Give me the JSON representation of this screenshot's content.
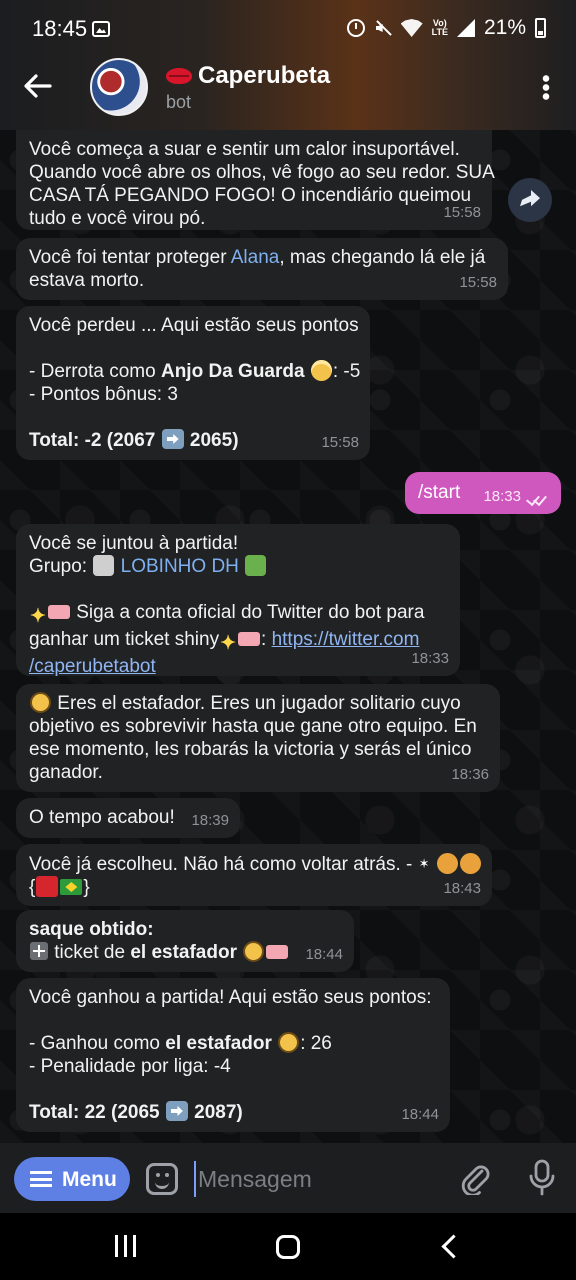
{
  "status_bar": {
    "time": "18:45",
    "battery": "21%",
    "volte_line1": "Vo)",
    "volte_line2": "LTE"
  },
  "header": {
    "title": "Caperubeta",
    "subtitle": "bot"
  },
  "messages": {
    "m1": {
      "lines": [
        "Você começa a suar e sentir um calor insuportável.",
        "Quando você abre os olhos, vê fogo ao seu redor. SUA",
        "CASA TÁ PEGANDO FOGO! O incendiário queimou",
        "tudo e você virou pó."
      ],
      "time": "15:58"
    },
    "m2": {
      "pre": "Você foi tentar proteger ",
      "mention": "Alana",
      "post": ", mas chegando lá ele já",
      "line2": "estava morto.",
      "time": "15:58"
    },
    "m3": {
      "line1": "Você perdeu ... Aqui estão seus pontos",
      "line2_pre": "- Derrota como ",
      "line2_bold": "Anjo Da Guarda",
      "line2_post": ": -5",
      "line3": "- Pontos bônus: 3",
      "total_a": "Total: -2 (2067",
      "total_b": "2065)",
      "time": "15:58"
    },
    "m4": {
      "text": "/start",
      "time": "18:33"
    },
    "m5": {
      "line1": "Você se juntou à partida!",
      "group_label": "Grupo:",
      "group_name": "LOBINHO DH",
      "line3": "Siga a conta oficial do Twitter do bot para",
      "line4_pre": "ganhar um ticket shiny",
      "link1": "https://twitter.com",
      "link2": "/caperubetabot",
      "time": "18:33"
    },
    "m6": {
      "lines": [
        "Eres el estafador. Eres un jugador solitario cuyo",
        "objetivo es sobrevivir hasta que gane otro equipo. En",
        "ese momento, les robarás la victoria y serás el único",
        "ganador."
      ],
      "time": "18:36"
    },
    "m7": {
      "text": "O tempo acabou!",
      "time": "18:39"
    },
    "m8": {
      "line1": "Você já escolheu. Não há como voltar atrás. -",
      "line2_open": "{",
      "line2_close": "}",
      "time": "18:43"
    },
    "m9": {
      "line1": "saque obtido:",
      "line2_pre": "ticket de ",
      "line2_bold": "el estafador",
      "time": "18:44"
    },
    "m10": {
      "line1": "Você ganhou a partida! Aqui estão seus pontos:",
      "line2_pre": "- Ganhou como ",
      "line2_bold": "el estafador",
      "line2_post": ": 26",
      "line3": "- Penalidade por liga: -4",
      "total_a": "Total: 22 (2065",
      "total_b": "2087)",
      "time": "18:44"
    }
  },
  "input_bar": {
    "menu_label": "Menu",
    "placeholder": "Mensagem"
  },
  "colors": {
    "outgoing_bubble": "#cf58bf",
    "incoming_bubble": "#212224",
    "menu_button": "#5e7fe4",
    "link": "#8fb5f2"
  }
}
